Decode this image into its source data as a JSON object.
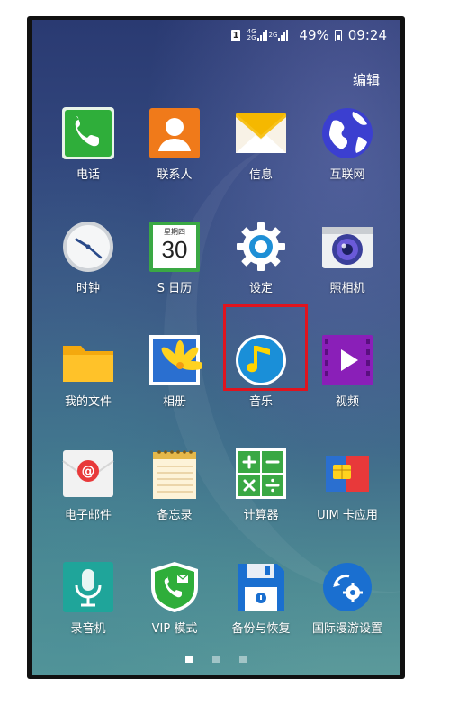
{
  "status": {
    "sim_label": "1",
    "net_a": "4G",
    "net_b": "2G",
    "net_c": "2G",
    "battery": "49%",
    "time": "09:24"
  },
  "header": {
    "edit_label": "编辑"
  },
  "apps": [
    {
      "label": "电话"
    },
    {
      "label": "联系人"
    },
    {
      "label": "信息"
    },
    {
      "label": "互联网"
    },
    {
      "label": "时钟"
    },
    {
      "label": "S 日历",
      "cal_month": "星期四",
      "cal_day": "30"
    },
    {
      "label": "设定"
    },
    {
      "label": "照相机"
    },
    {
      "label": "我的文件"
    },
    {
      "label": "相册"
    },
    {
      "label": "音乐"
    },
    {
      "label": "视频"
    },
    {
      "label": "电子邮件"
    },
    {
      "label": "备忘录"
    },
    {
      "label": "计算器"
    },
    {
      "label": "UIM 卡应用"
    },
    {
      "label": "录音机"
    },
    {
      "label": "VIP 模式"
    },
    {
      "label": "备份与恢复"
    },
    {
      "label": "国际漫游设置"
    }
  ],
  "highlighted_app": "设定",
  "pager": {
    "pages": 3,
    "current": 1
  }
}
